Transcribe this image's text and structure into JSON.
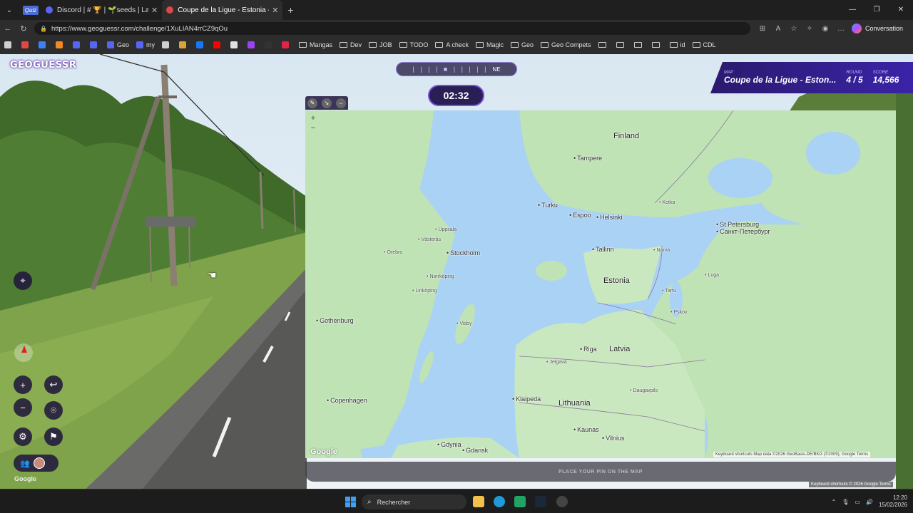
{
  "browser": {
    "tabs": [
      {
        "label": "Quiz",
        "type": "badge"
      },
      {
        "label": "Discord | # 🏆 | 🌱seeds | La Ligu",
        "fav_color": "#5865f2"
      },
      {
        "label": "Coupe de la Ligue - Estonia - Cha",
        "fav_color": "#e04848"
      }
    ],
    "url": "https://www.geoguessr.com/challenge/1XuLIAN4rrCZ9qOu",
    "conversation_label": "Conversation",
    "bookmarks": [
      {
        "label": "",
        "icon": "grid-icon",
        "color": "#cfcfcf"
      },
      {
        "label": "",
        "icon": "gmail-icon",
        "color": "#e04848"
      },
      {
        "label": "",
        "icon": "app-icon",
        "color": "#3b82f6"
      },
      {
        "label": "",
        "icon": "orange-icon",
        "color": "#f08a24"
      },
      {
        "label": "",
        "icon": "discord-icon",
        "color": "#5865f2"
      },
      {
        "label": "",
        "icon": "discord-icon",
        "color": "#5865f2"
      },
      {
        "label": "Geo",
        "icon": "discord-icon",
        "color": "#5865f2"
      },
      {
        "label": "my",
        "icon": "discord-icon",
        "color": "#5865f2"
      },
      {
        "label": "",
        "icon": "leaf-icon",
        "color": "#cfcfcf"
      },
      {
        "label": "",
        "icon": "mc-icon",
        "color": "#d7a63a"
      },
      {
        "label": "",
        "icon": "facebook-icon",
        "color": "#1877f2"
      },
      {
        "label": "",
        "icon": "youtube-icon",
        "color": "#ff0000"
      },
      {
        "label": "",
        "icon": "circle-icon",
        "color": "#e0e0e0"
      },
      {
        "label": "",
        "icon": "heart-icon",
        "color": "#9b42f5"
      },
      {
        "label": "",
        "icon": "e-icon",
        "color": "#333333"
      },
      {
        "label": "",
        "icon": "f-icon",
        "color": "#e0244a"
      }
    ],
    "bookmark_folders": [
      "Mangas",
      "Dev",
      "JOB",
      "TODO",
      "A check",
      "Magic",
      "Geo",
      "Geo Compets",
      "",
      "",
      "",
      "",
      "id",
      "CDL"
    ]
  },
  "game": {
    "logo": "GEOGUESSR",
    "compass_heading": "NE",
    "timer": "02:32",
    "map_label": "MAP",
    "map_name": "Coupe de la Ligue - Eston...",
    "round_label": "ROUND",
    "round_value": "4 / 5",
    "score_label": "SCORE",
    "score_value": "14,566",
    "place_pin_text": "PLACE YOUR PIN ON THE MAP",
    "street_google": "Google",
    "street_attr": "Keyboard shortcuts   © 2026 Google   Terms",
    "map_attr": "Keyboard shortcuts   Map data ©2026 GeoBasis-DE/BKG (©2009), Google   Terms",
    "map_google": "Google"
  },
  "map": {
    "countries": [
      {
        "name": "Finland"
      },
      {
        "name": "Estonia"
      },
      {
        "name": "Latvia"
      },
      {
        "name": "Lithuania"
      }
    ],
    "cities": [
      {
        "name": "Tampere"
      },
      {
        "name": "Turku"
      },
      {
        "name": "Espoo"
      },
      {
        "name": "Helsinki"
      },
      {
        "name": "Stockholm"
      },
      {
        "name": "Tallinn"
      },
      {
        "name": "Riga"
      },
      {
        "name": "Gothenburg"
      },
      {
        "name": "Copenhagen"
      },
      {
        "name": "Klaipeda"
      },
      {
        "name": "Kaunas"
      },
      {
        "name": "Vilnius"
      },
      {
        "name": "Gdansk"
      },
      {
        "name": "Gdynia"
      },
      {
        "name": "St Petersburg"
      },
      {
        "name": "Санкт-Петербург"
      },
      {
        "name": "Narva"
      },
      {
        "name": "Kotka"
      },
      {
        "name": "Uppsala"
      },
      {
        "name": "Västerås"
      },
      {
        "name": "Örebro"
      },
      {
        "name": "Norrköping"
      },
      {
        "name": "Linköping"
      },
      {
        "name": "Visby"
      },
      {
        "name": "Jelgava"
      },
      {
        "name": "Daugavpils"
      },
      {
        "name": "Pskov"
      },
      {
        "name": "Tartu"
      },
      {
        "name": "Luga"
      }
    ]
  },
  "taskbar": {
    "search_label": "Rechercher",
    "time": "12:20",
    "date": "15/02/2026"
  }
}
